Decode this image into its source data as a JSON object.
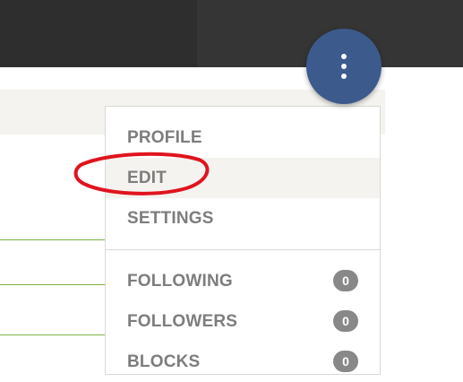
{
  "header": {
    "menu_button_icon": "vertical-ellipsis-icon",
    "menu_button_color": "#3d5a8c"
  },
  "menu": {
    "items": [
      {
        "label": "PROFILE"
      },
      {
        "label": "EDIT",
        "highlighted": true
      },
      {
        "label": "SETTINGS"
      }
    ],
    "social": [
      {
        "label": "FOLLOWING",
        "count": "0"
      },
      {
        "label": "FOLLOWERS",
        "count": "0"
      },
      {
        "label": "BLOCKS",
        "count": "0"
      }
    ]
  },
  "annotation": {
    "shape": "red-ellipse",
    "color": "#e0141e"
  },
  "colors": {
    "topbar": "#2e2e2e",
    "accent_line": "#7cb342",
    "menu_text": "#7d7d7d",
    "badge": "#888888"
  }
}
